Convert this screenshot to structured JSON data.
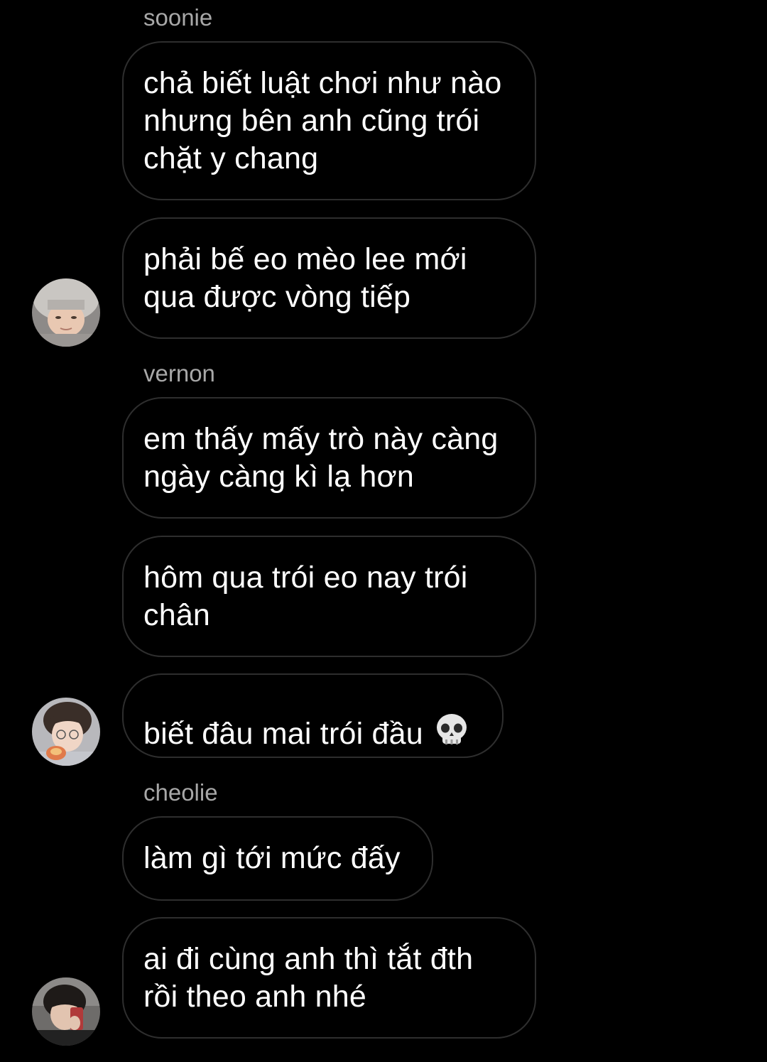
{
  "theme": {
    "background": "#000000",
    "bubble_border": "#2e2e2e",
    "text": "#ffffff",
    "sender_text": "#a8a8a8"
  },
  "groups": [
    {
      "sender": "soonie",
      "avatar_icon": "user-avatar-soonie",
      "messages": [
        "chả biết luật chơi như nào\nnhưng bên anh cũng trói\nchặt y chang",
        "phải bế eo mèo lee mới\nqua được vòng tiếp"
      ]
    },
    {
      "sender": "vernon",
      "avatar_icon": "user-avatar-vernon",
      "messages": [
        "em thấy mấy trò này càng\nngày càng kì lạ hơn",
        "hôm qua trói eo nay trói\nchân",
        "biết đâu mai trói đầu"
      ],
      "emoji": "skull-emoji"
    },
    {
      "sender": "cheolie",
      "avatar_icon": "user-avatar-cheolie",
      "messages": [
        "làm gì tới mức đấy",
        "ai đi cùng anh thì tắt đth\nrồi theo anh nhé"
      ]
    }
  ]
}
